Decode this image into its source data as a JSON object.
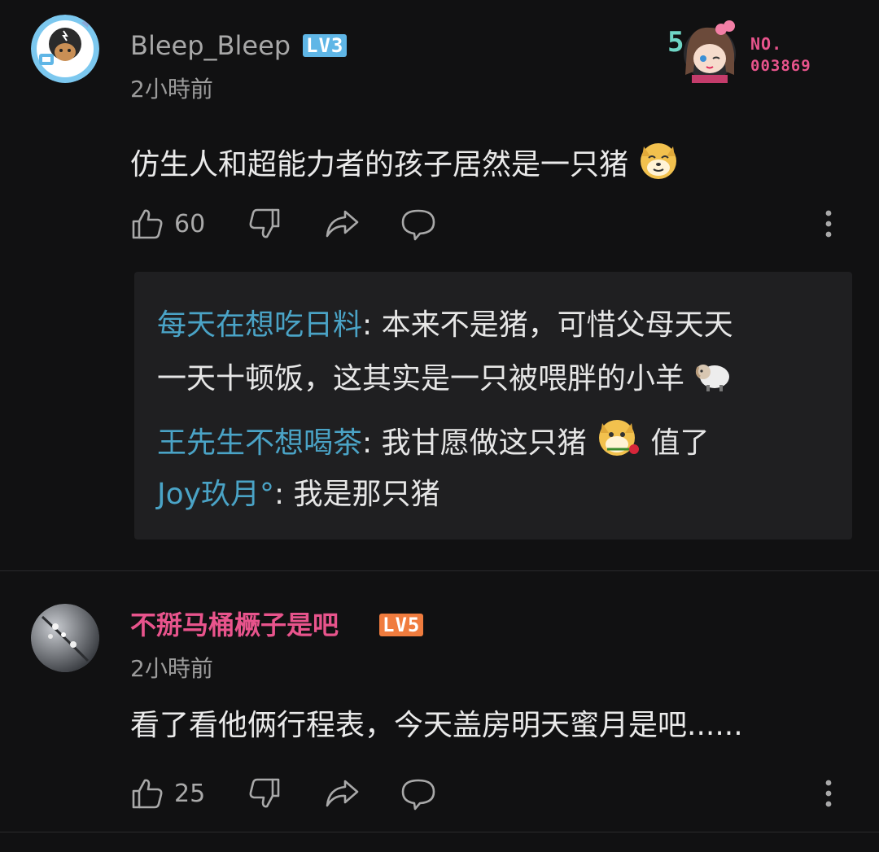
{
  "comments": [
    {
      "username": "Bleep_Bleep",
      "level": "LV3",
      "time": "2小時前",
      "content": "仿生人和超能力者的孩子居然是一只猪",
      "likes": "60",
      "fan_badge": {
        "label": "NO.",
        "number": "003869",
        "rank": "5"
      },
      "replies": [
        {
          "author": "每天在想吃日料",
          "sep": ": ",
          "text_line1": "本来不是猪，可惜父母天天",
          "text_line2": "一天十顿饭，这其实是一只被喂胖的小羊"
        },
        {
          "author": "王先生不想喝茶",
          "sep": ": ",
          "text": "我甘愿做这只猪",
          "text_after": "值了"
        },
        {
          "author": "Joy玖月°",
          "sep": ": ",
          "text": "我是那只猪"
        }
      ]
    },
    {
      "username": "不掰马桶橛子是吧",
      "level": "LV5",
      "time": "2小時前",
      "content": "看了看他俩行程表，今天盖房明天蜜月是吧......",
      "likes": "25"
    }
  ],
  "colors": {
    "background": "#111112",
    "reply_box": "#1f1f21",
    "reply_author": "#4aa3c6",
    "vip_name": "#e8548c",
    "lv3_badge": "#5fb6e6",
    "lv5_badge": "#f07c3e"
  },
  "icons": [
    "like-icon",
    "dislike-icon",
    "share-icon",
    "reply-icon",
    "more-icon",
    "doge-emoji",
    "sheep-emoji",
    "doge-rose-emoji"
  ]
}
